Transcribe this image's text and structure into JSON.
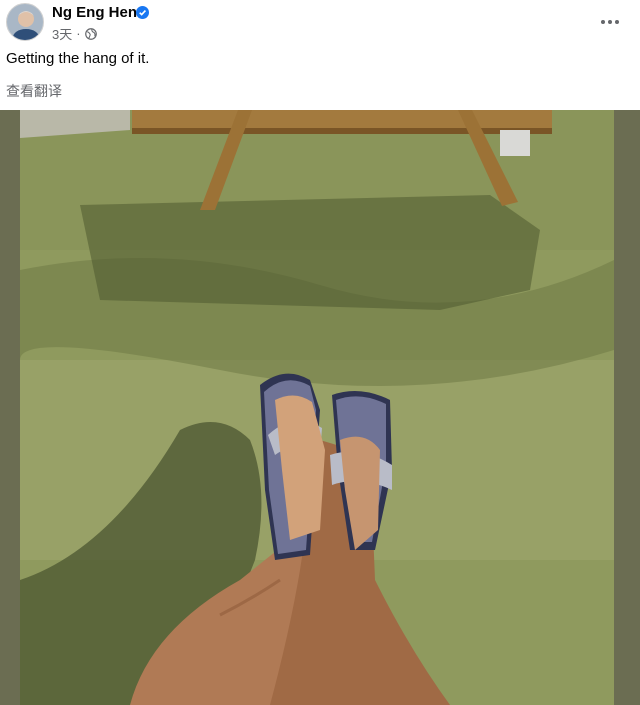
{
  "post": {
    "author": "Ng Eng Hen",
    "verified_icon": "verified-badge-icon",
    "timestamp": "3天",
    "separator": "·",
    "audience_icon": "globe-icon",
    "more_icon": "more-options-icon",
    "text": "Getting the hang of it.",
    "see_translation": "查看翻译",
    "photo_icon": "photo-sandals-on-grass",
    "accent_color": "#1877f2"
  }
}
